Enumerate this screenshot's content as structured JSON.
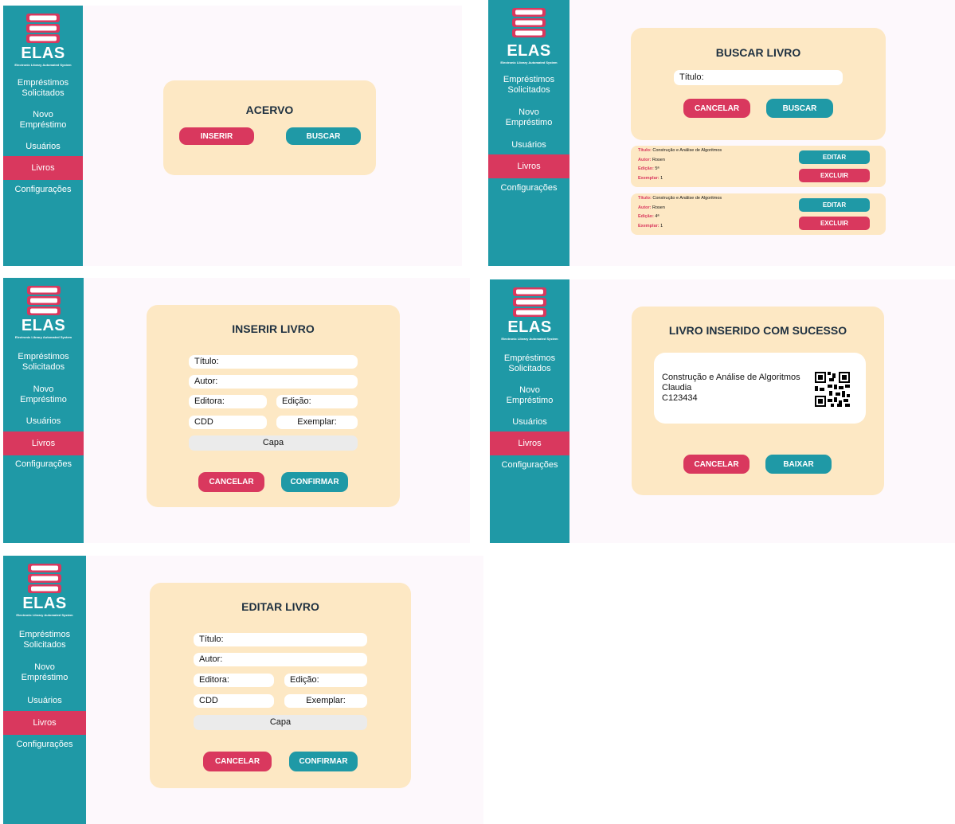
{
  "app": {
    "brand": "ELAS",
    "tagline": "Electronic Library Automated System"
  },
  "nav": [
    "Empréstimos\nSolicitados",
    "Novo\nEmpréstimo",
    "Usuários",
    "Livros",
    "Configurações"
  ],
  "colors": {
    "teal": "#1f99a6",
    "pink": "#d9385e",
    "card": "#fde8c4",
    "background": "#fdf8fc"
  },
  "acervo": {
    "title": "ACERVO",
    "insert_label": "INSERIR",
    "search_label": "BUSCAR"
  },
  "search": {
    "title": "BUSCAR LIVRO",
    "title_field": "Título:",
    "cancel_label": "CANCELAR",
    "search_label": "BUSCAR",
    "labels": {
      "title": "Título:",
      "author": "Autor:",
      "edition": "Edição:",
      "copy": "Exemplar:"
    },
    "results": [
      {
        "title": "Construção e Análise de Algoritmos",
        "author": "Rosen",
        "edition": "5ª",
        "copy": "1",
        "edit_label": "EDITAR",
        "delete_label": "EXCLUIR"
      },
      {
        "title": "Construção e Análise de Algoritmos",
        "author": "Rosen",
        "edition": "4ª",
        "copy": "1",
        "edit_label": "EDITAR",
        "delete_label": "EXCLUIR"
      }
    ]
  },
  "insert": {
    "title": "INSERIR LIVRO",
    "fields": {
      "title": "Título:",
      "author": "Autor:",
      "publisher": "Editora:",
      "edition": "Edição:",
      "cdd": "CDD",
      "copy": "Exemplar:",
      "cover": "Capa"
    },
    "cancel_label": "CANCELAR",
    "confirm_label": "CONFIRMAR"
  },
  "success": {
    "title": "LIVRO INSERIDO COM SUCESSO",
    "book_title": "Construção e Análise de Algoritmos",
    "author": "Claudia",
    "code": "C123434",
    "qr_icon": "qr-code-icon",
    "cancel_label": "CANCELAR",
    "download_label": "BAIXAR"
  },
  "edit": {
    "title": "EDITAR LIVRO",
    "fields": {
      "title": "Título:",
      "author": "Autor:",
      "publisher": "Editora:",
      "edition": "Edição:",
      "cdd": "CDD",
      "copy": "Exemplar:",
      "cover": "Capa"
    },
    "cancel_label": "CANCELAR",
    "confirm_label": "CONFIRMAR"
  }
}
